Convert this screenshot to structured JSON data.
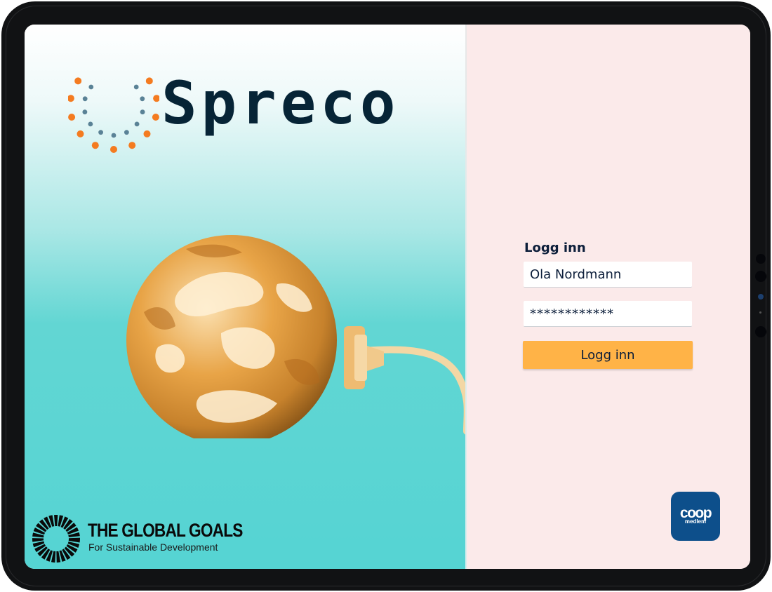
{
  "brand": {
    "name": "Spreco",
    "dot_colors": {
      "orange": "#f47b20",
      "slate": "#5a8296"
    }
  },
  "login": {
    "heading": "Logg inn",
    "username_value": "Ola Nordmann",
    "password_value": "************",
    "submit_label": "Logg inn"
  },
  "global_goals": {
    "title": "THE GLOBAL GOALS",
    "subtitle": "For Sustainable Development"
  },
  "coop": {
    "word": "coop",
    "sub": "medlem",
    "color": "#0d4f8b"
  },
  "colors": {
    "accent_button": "#ffb347",
    "right_background": "#fbeaea",
    "teal": "#55d4d3",
    "text_dark": "#0c1e3a"
  }
}
